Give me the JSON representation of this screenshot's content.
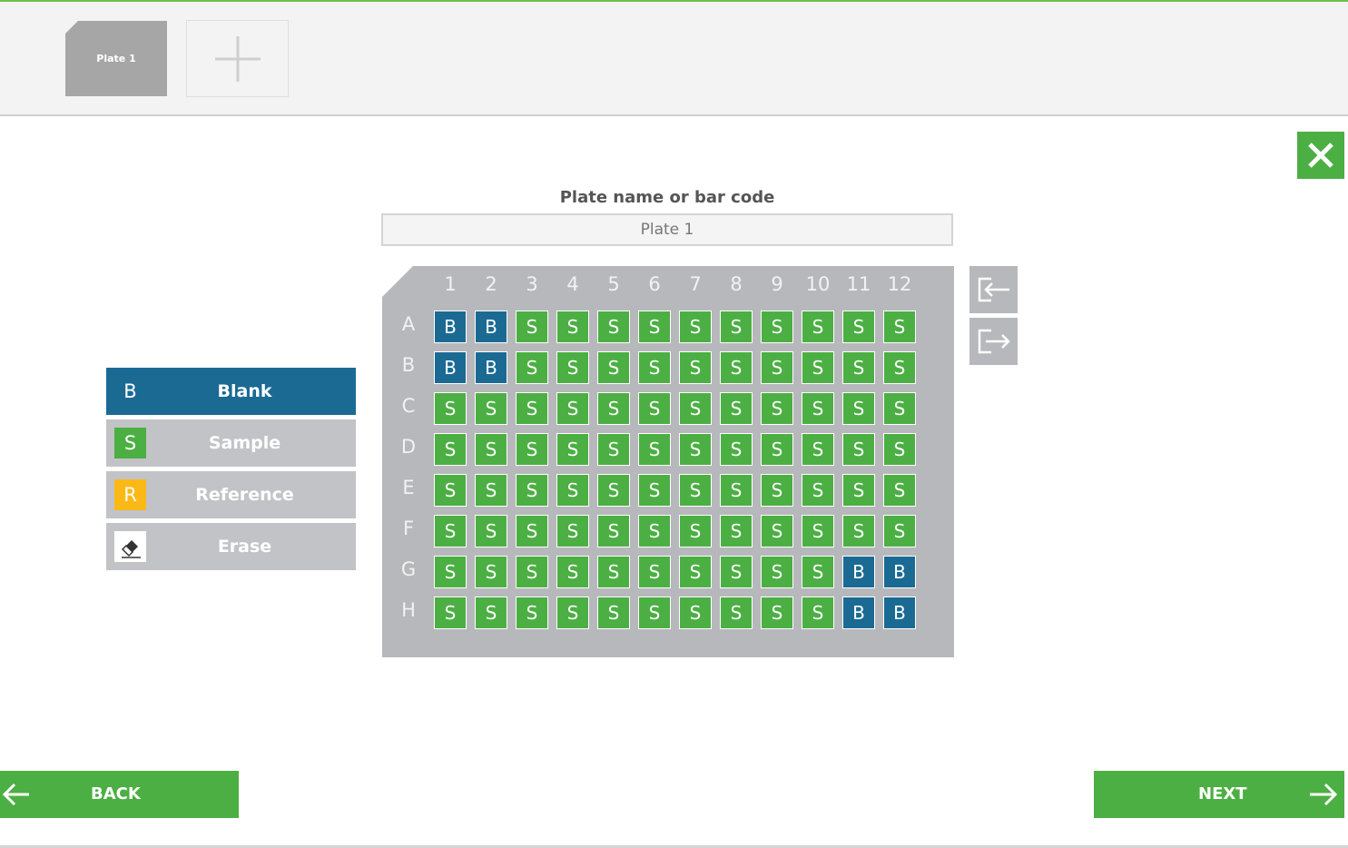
{
  "tabs": {
    "plate_tab": "Plate 1",
    "add_tab_icon": "plus-icon"
  },
  "form": {
    "label": "Plate name or bar code",
    "value": "Plate 1"
  },
  "plate": {
    "columns": [
      "1",
      "2",
      "3",
      "4",
      "5",
      "6",
      "7",
      "8",
      "9",
      "10",
      "11",
      "12"
    ],
    "rows": [
      {
        "label": "A",
        "wells": [
          "B",
          "B",
          "S",
          "S",
          "S",
          "S",
          "S",
          "S",
          "S",
          "S",
          "S",
          "S"
        ]
      },
      {
        "label": "B",
        "wells": [
          "B",
          "B",
          "S",
          "S",
          "S",
          "S",
          "S",
          "S",
          "S",
          "S",
          "S",
          "S"
        ]
      },
      {
        "label": "C",
        "wells": [
          "S",
          "S",
          "S",
          "S",
          "S",
          "S",
          "S",
          "S",
          "S",
          "S",
          "S",
          "S"
        ]
      },
      {
        "label": "D",
        "wells": [
          "S",
          "S",
          "S",
          "S",
          "S",
          "S",
          "S",
          "S",
          "S",
          "S",
          "S",
          "S"
        ]
      },
      {
        "label": "E",
        "wells": [
          "S",
          "S",
          "S",
          "S",
          "S",
          "S",
          "S",
          "S",
          "S",
          "S",
          "S",
          "S"
        ]
      },
      {
        "label": "F",
        "wells": [
          "S",
          "S",
          "S",
          "S",
          "S",
          "S",
          "S",
          "S",
          "S",
          "S",
          "S",
          "S"
        ]
      },
      {
        "label": "G",
        "wells": [
          "S",
          "S",
          "S",
          "S",
          "S",
          "S",
          "S",
          "S",
          "S",
          "S",
          "B",
          "B"
        ]
      },
      {
        "label": "H",
        "wells": [
          "S",
          "S",
          "S",
          "S",
          "S",
          "S",
          "S",
          "S",
          "S",
          "S",
          "B",
          "B"
        ]
      }
    ]
  },
  "legend": [
    {
      "key": "B",
      "label": "Blank",
      "color": "#1b6a93",
      "active": true
    },
    {
      "key": "S",
      "label": "Sample",
      "color": "#4caf43",
      "active": false
    },
    {
      "key": "R",
      "label": "Reference",
      "color": "#fbb917",
      "active": false
    },
    {
      "key": "",
      "label": "Erase",
      "color": "#ffffff",
      "icon": "eraser-icon",
      "active": false
    }
  ],
  "side_buttons": [
    "import-icon",
    "export-icon"
  ],
  "nav": {
    "back": "BACK",
    "next": "NEXT"
  },
  "colors": {
    "green": "#4caf43",
    "blue": "#1b6a93",
    "gray": "#b7b8bb",
    "amber": "#fbb917"
  }
}
